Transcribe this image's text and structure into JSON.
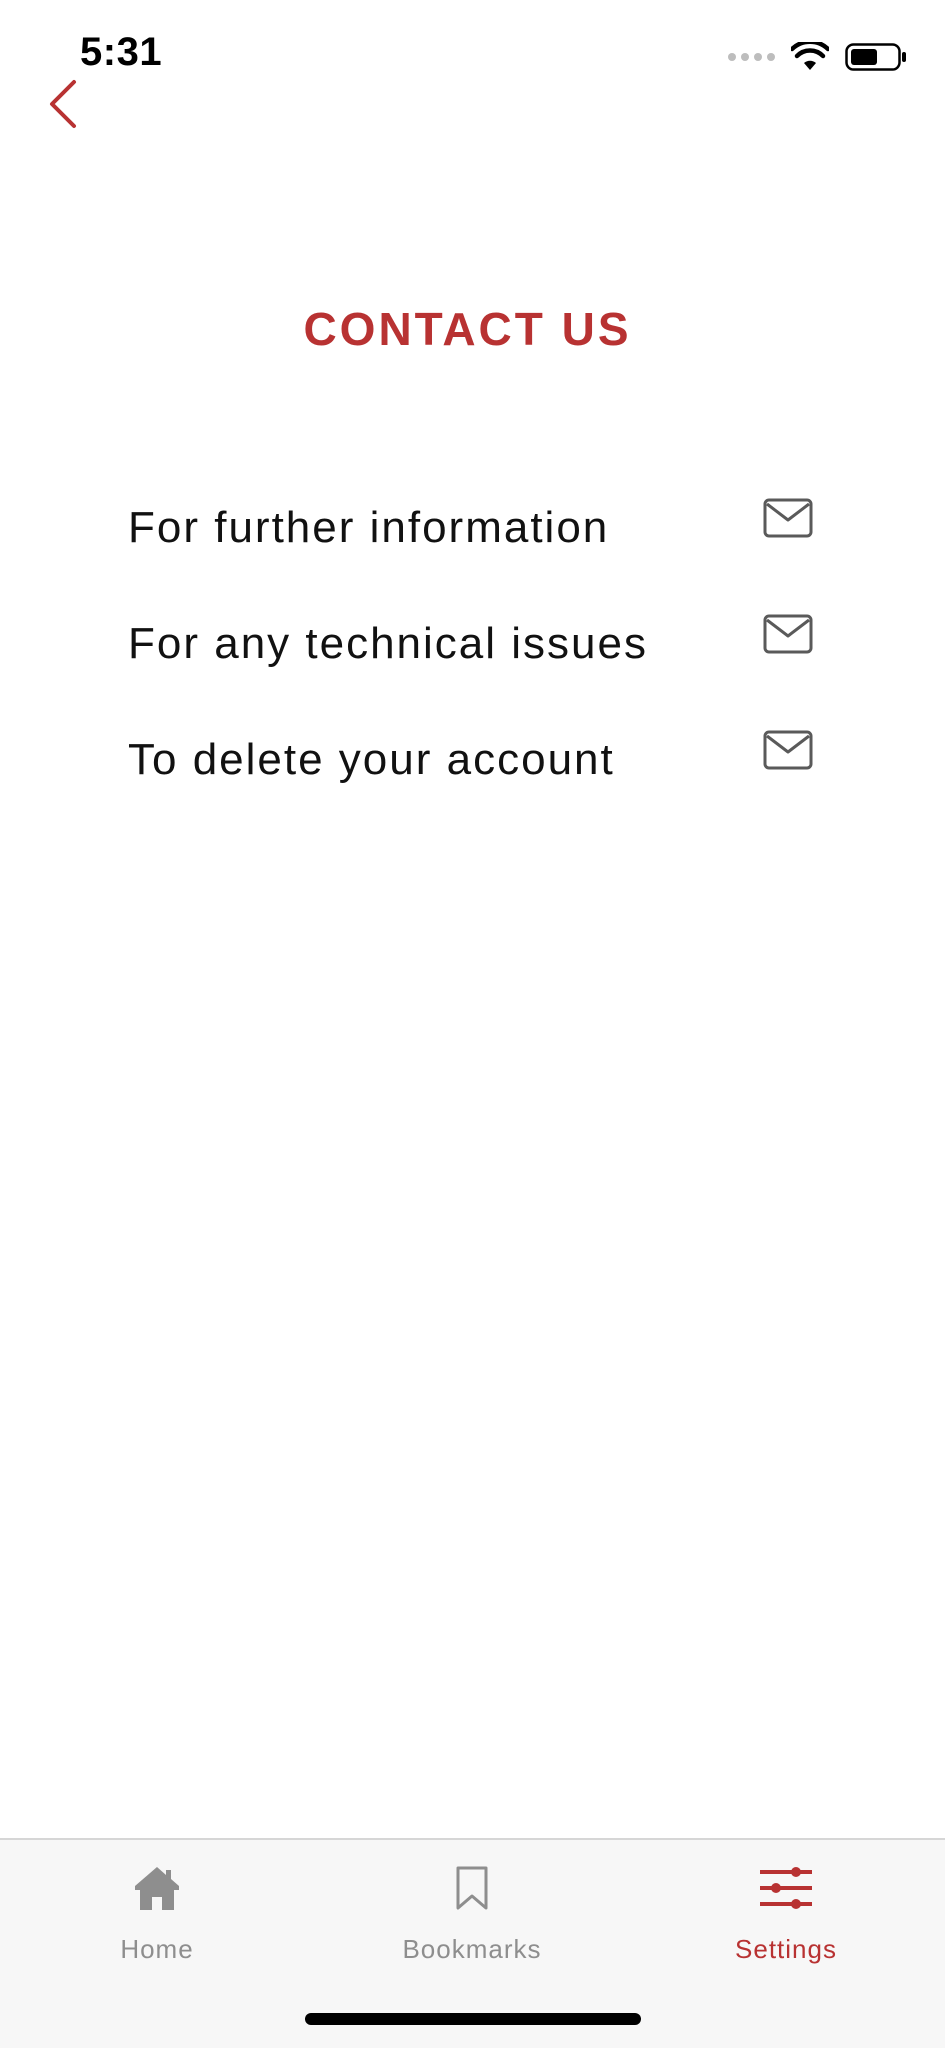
{
  "status_bar": {
    "time": "5:31"
  },
  "header": {
    "back_icon": "chevron-left-icon",
    "title": "CONTACT US"
  },
  "contacts": [
    {
      "label": "For further information",
      "icon": "mail-icon"
    },
    {
      "label": "For any technical issues",
      "icon": "mail-icon"
    },
    {
      "label": "To delete your account",
      "icon": "mail-icon"
    }
  ],
  "tab_bar": {
    "tabs": [
      {
        "label": "Home",
        "icon": "home-icon",
        "active": false
      },
      {
        "label": "Bookmarks",
        "icon": "bookmark-icon",
        "active": false
      },
      {
        "label": "Settings",
        "icon": "sliders-icon",
        "active": true
      }
    ]
  },
  "colors": {
    "accent": "#b83232",
    "inactive": "#8e8e8e",
    "text": "#111111",
    "icon_gray": "#5a5a5a"
  }
}
